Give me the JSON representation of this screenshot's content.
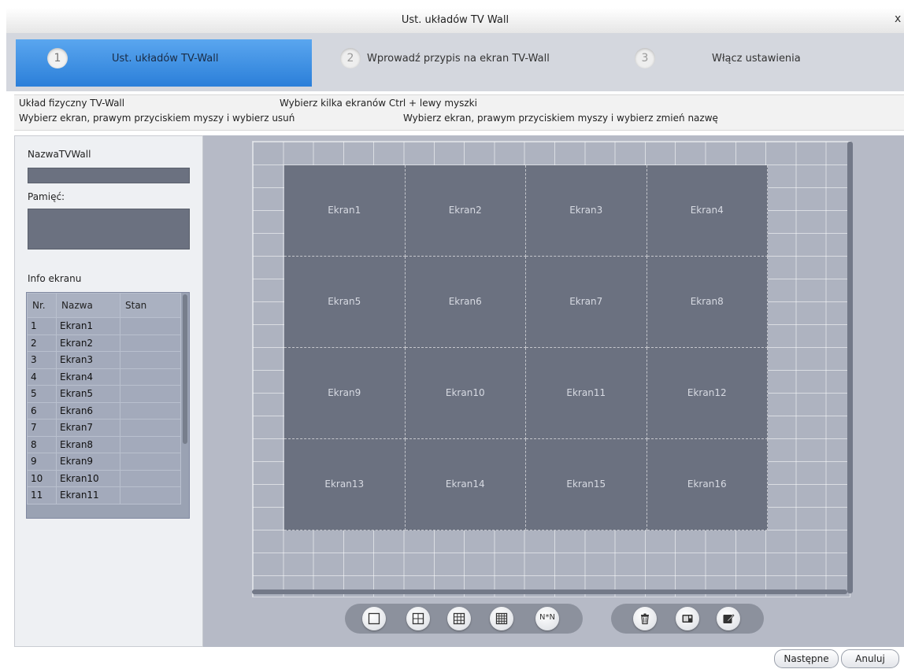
{
  "window": {
    "title": "Ust. układów TV Wall",
    "close_glyph": "x"
  },
  "steps": [
    {
      "num": "1",
      "label": "Ust. układów TV-Wall",
      "active": true
    },
    {
      "num": "2",
      "label": "Wprowadź przypis na ekran TV-Wall",
      "active": false
    },
    {
      "num": "3",
      "label": "Włącz ustawienia",
      "active": false
    }
  ],
  "hints": {
    "physical": "Układ fizyczny TV-Wall",
    "multi_select": "Wybierz kilka ekranów Ctrl + lewy myszki",
    "delete": "Wybierz ekran, prawym przyciskiem myszy i wybierz usuń",
    "rename": "Wybierz ekran, prawym przyciskiem myszy i wybierz zmień nazwę"
  },
  "left": {
    "name_label": "NazwaTVWall",
    "name_value": "",
    "memory_label": "Pamięć:",
    "memory_value": "",
    "info_label": "Info ekranu",
    "table": {
      "columns": [
        "Nr.",
        "Nazwa",
        "Stan"
      ],
      "rows": [
        [
          "1",
          "Ekran1",
          ""
        ],
        [
          "2",
          "Ekran2",
          ""
        ],
        [
          "3",
          "Ekran3",
          ""
        ],
        [
          "4",
          "Ekran4",
          ""
        ],
        [
          "5",
          "Ekran5",
          ""
        ],
        [
          "6",
          "Ekran6",
          ""
        ],
        [
          "7",
          "Ekran7",
          ""
        ],
        [
          "8",
          "Ekran8",
          ""
        ],
        [
          "9",
          "Ekran9",
          ""
        ],
        [
          "10",
          "Ekran10",
          ""
        ],
        [
          "11",
          "Ekran11",
          ""
        ]
      ]
    }
  },
  "wall": {
    "screens": [
      "Ekran1",
      "Ekran2",
      "Ekran3",
      "Ekran4",
      "Ekran5",
      "Ekran6",
      "Ekran7",
      "Ekran8",
      "Ekran9",
      "Ekran10",
      "Ekran11",
      "Ekran12",
      "Ekran13",
      "Ekran14",
      "Ekran15",
      "Ekran16"
    ]
  },
  "toolbar": {
    "layout_buttons": [
      "layout-1x1-icon",
      "layout-2x2-icon",
      "layout-3x3-icon",
      "layout-4x4-icon",
      "layout-nxn"
    ],
    "nxn_label": "N*N",
    "edit_buttons": [
      "trash-icon",
      "screen-icon",
      "edit-icon"
    ]
  },
  "buttons": {
    "next": "Następne",
    "cancel": "Anuluj"
  },
  "colors": {
    "accent": "#2b7fd9",
    "screen_fill": "#6b7180",
    "canvas_bg": "#b6bac6"
  }
}
